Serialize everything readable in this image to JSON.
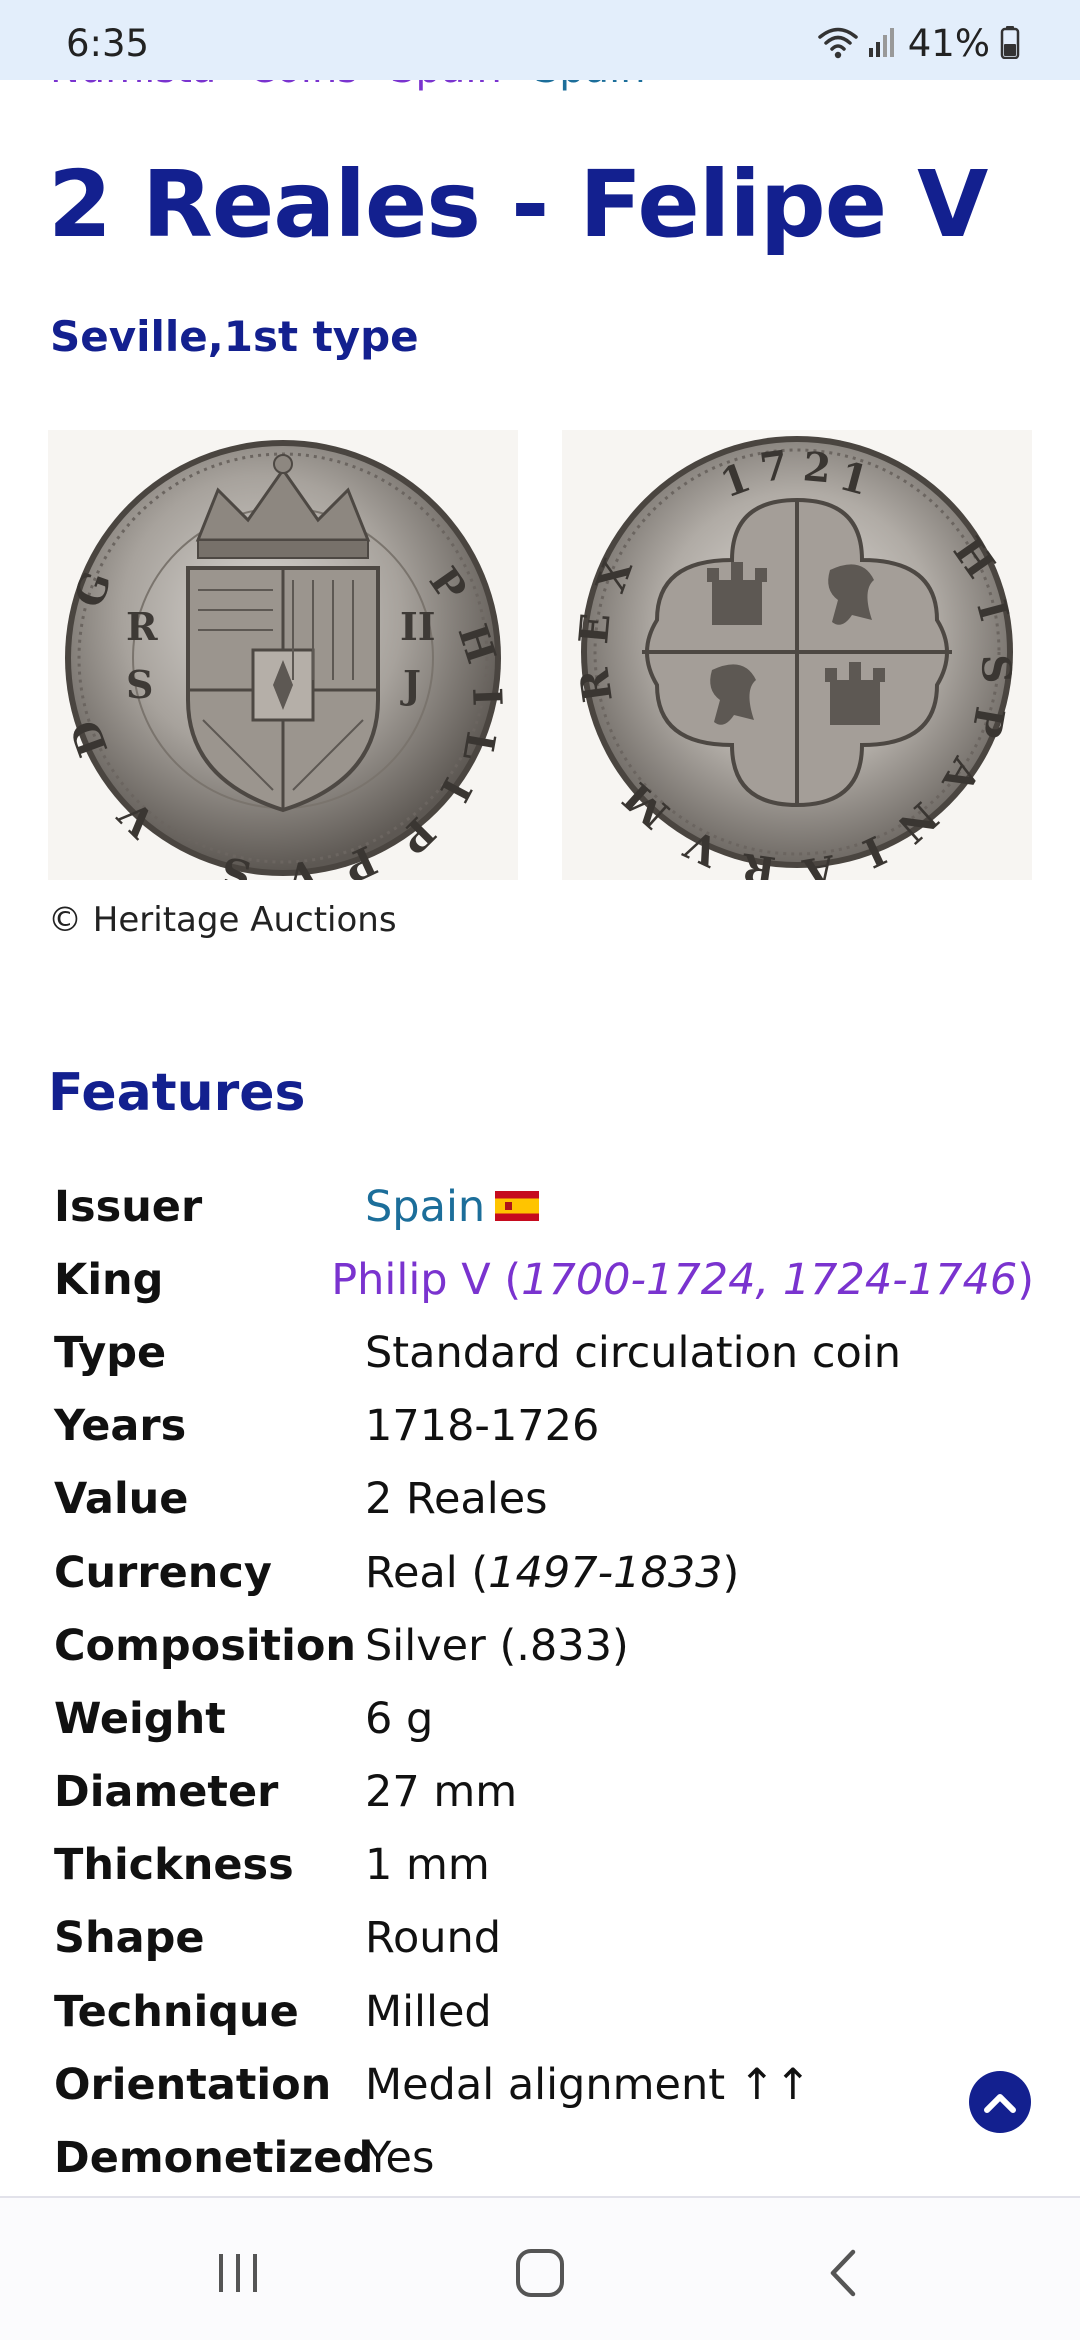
{
  "status_bar": {
    "time": "6:35",
    "battery_text": "41%",
    "icons": [
      "wifi-icon",
      "signal-icon",
      "battery-icon"
    ]
  },
  "breadcrumb": {
    "items": [
      "Numista",
      "Coins",
      "Spain",
      "Spain"
    ]
  },
  "coin": {
    "title": "2 Reales - Felipe V",
    "subtitle": "Seville,1st type",
    "image_credit": "© Heritage Auctions"
  },
  "features": {
    "heading": "Features",
    "rows": [
      {
        "label": "Issuer",
        "value": "Spain"
      },
      {
        "label": "King",
        "value_main": "Philip V (",
        "value_italic": "1700-1724, 1724-1746",
        "value_end": ")"
      },
      {
        "label": "Type",
        "value": "Standard circulation coin"
      },
      {
        "label": "Years",
        "value": "1718-1726"
      },
      {
        "label": "Value",
        "value": "2 Reales"
      },
      {
        "label": "Currency",
        "value_main": "Real (",
        "value_italic": "1497-1833",
        "value_end": ")"
      },
      {
        "label": "Composition",
        "value": "Silver (.833)"
      },
      {
        "label": "Weight",
        "value": "6 g"
      },
      {
        "label": "Diameter",
        "value": "27 mm"
      },
      {
        "label": "Thickness",
        "value": "1 mm"
      },
      {
        "label": "Shape",
        "value": "Round"
      },
      {
        "label": "Technique",
        "value": "Milled"
      },
      {
        "label": "Orientation",
        "value": "Medal alignment ↑↑"
      },
      {
        "label": "Demonetized",
        "value": "Yes"
      }
    ]
  },
  "colors": {
    "title": "#13208f",
    "link_blue": "#1c6e9a",
    "link_purple": "#7a33cf",
    "status_bar_bg": "#e3eefb"
  },
  "nav": {
    "buttons": [
      "recent-apps-icon",
      "home-icon",
      "back-icon"
    ]
  }
}
